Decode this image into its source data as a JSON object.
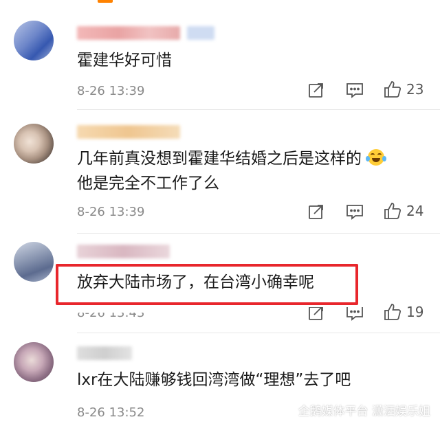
{
  "comments": [
    {
      "text_lines": [
        "霍建华好可惜"
      ],
      "time": "8-26 13:39",
      "likes": "23"
    },
    {
      "text_lines": [
        "几年前真没想到霍建华结婚之后是这样的",
        "他是完全不工作了么"
      ],
      "emoji": "crying-laughing-emoji",
      "time": "8-26 13:39",
      "likes": "24"
    },
    {
      "text_lines": [
        "放弃大陆市场了，在台湾小确幸呢"
      ],
      "time": "8-26 13:43",
      "likes": "19",
      "highlighted": true,
      "highlight_color": "#e8262c"
    },
    {
      "text_lines": [
        "lxr在大陆赚够钱回湾湾做“理想”去了吧"
      ],
      "time": "8-26 13:52",
      "likes": ""
    }
  ],
  "watermark": {
    "text": "企鹅媒体平台 潇洒娱乐姐"
  },
  "colors": {
    "accent": "#ff8200",
    "highlight": "#e8262c",
    "time_text": "#8a8a8a"
  }
}
